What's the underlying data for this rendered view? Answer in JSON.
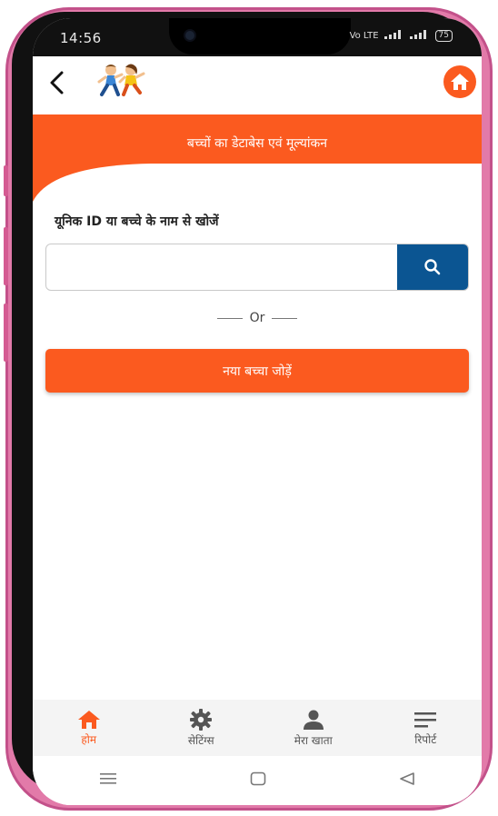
{
  "status_bar": {
    "time": "14:56",
    "network_label": "Vo LTE",
    "battery": "75"
  },
  "header": {
    "back_icon": "back-arrow-icon",
    "logo_icon": "children-running-logo",
    "home_icon": "home-icon"
  },
  "banner": {
    "title": "बच्चों का  डेटाबेस एवं मूल्यांकन"
  },
  "search": {
    "label": "यूनिक ID या बच्चे के नाम से खोजें",
    "value": "",
    "placeholder": "",
    "button_icon": "search-icon"
  },
  "divider": {
    "text": "Or"
  },
  "actions": {
    "add_child_label": "नया बच्चा जोड़ें"
  },
  "bottom_nav": {
    "items": [
      {
        "label": "होम",
        "icon": "home-icon",
        "active": true
      },
      {
        "label": "सेटिंग्स",
        "icon": "gear-icon",
        "active": false
      },
      {
        "label": "मेरा खाता",
        "icon": "person-icon",
        "active": false
      },
      {
        "label": "रिपोर्ट",
        "icon": "menu-lines-icon",
        "active": false
      }
    ]
  },
  "colors": {
    "accent": "#fb5a1f",
    "search_button": "#0b5592",
    "frame": "#e27aa9"
  }
}
